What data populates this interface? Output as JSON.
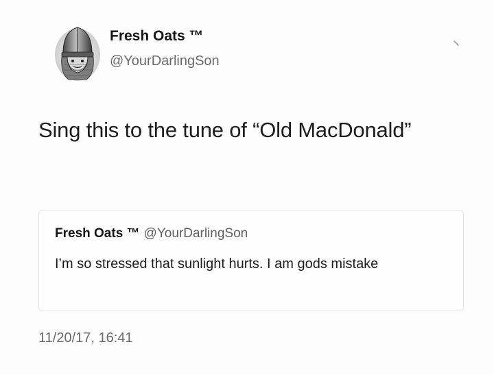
{
  "tweet": {
    "author": {
      "display_name": "Fresh Oats ™",
      "handle": "@YourDarlingSon",
      "avatar_icon": "knight-helmet-avatar"
    },
    "menu_icon": "chevron-down-icon",
    "text": "Sing this to the tune of “Old MacDonald”",
    "timestamp": "11/20/17, 16:41"
  },
  "quoted_tweet": {
    "author": {
      "display_name": "Fresh Oats ™",
      "handle": "@YourDarlingSon"
    },
    "text": "I’m so stressed that sunlight hurts. I am gods mistake"
  }
}
